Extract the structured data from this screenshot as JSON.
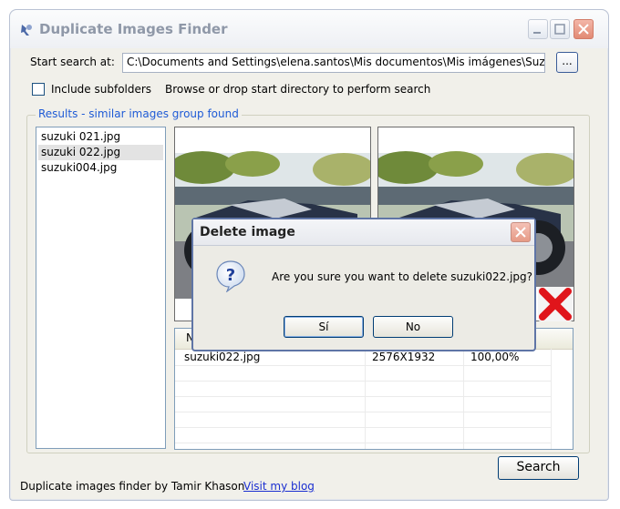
{
  "window": {
    "title": "Duplicate Images Finder"
  },
  "search": {
    "label": "Start search at:",
    "path": "C:\\Documents and Settings\\elena.santos\\Mis documentos\\Mis imágenes\\Suzu",
    "browse_label": "...",
    "include_subfolders_label": "Include subfolders",
    "include_subfolders_checked": false,
    "hint": "Browse or drop start directory to perform search"
  },
  "results": {
    "legend": "Results - similar images group found",
    "files": [
      "suzuki 021.jpg",
      "suzuki 022.jpg",
      "suzuki004.jpg"
    ],
    "selected_index": 1
  },
  "grid": {
    "header_first": "Na",
    "rows": [
      {
        "name": "suzuki022.jpg",
        "size": "2576X1932",
        "similarity": "100,00%"
      }
    ]
  },
  "dialog": {
    "title": "Delete image",
    "message": "Are you sure you want to delete suzuki022.jpg?",
    "yes_label": "Sí",
    "no_label": "No",
    "icon": "question-icon"
  },
  "footer": {
    "credit": "Duplicate images finder by Tamir Khason",
    "link": "Visit my blog",
    "search_label": "Search"
  },
  "colors": {
    "accent": "#1f5bd6",
    "link": "#1b2fd1",
    "delete": "#e0151b"
  }
}
